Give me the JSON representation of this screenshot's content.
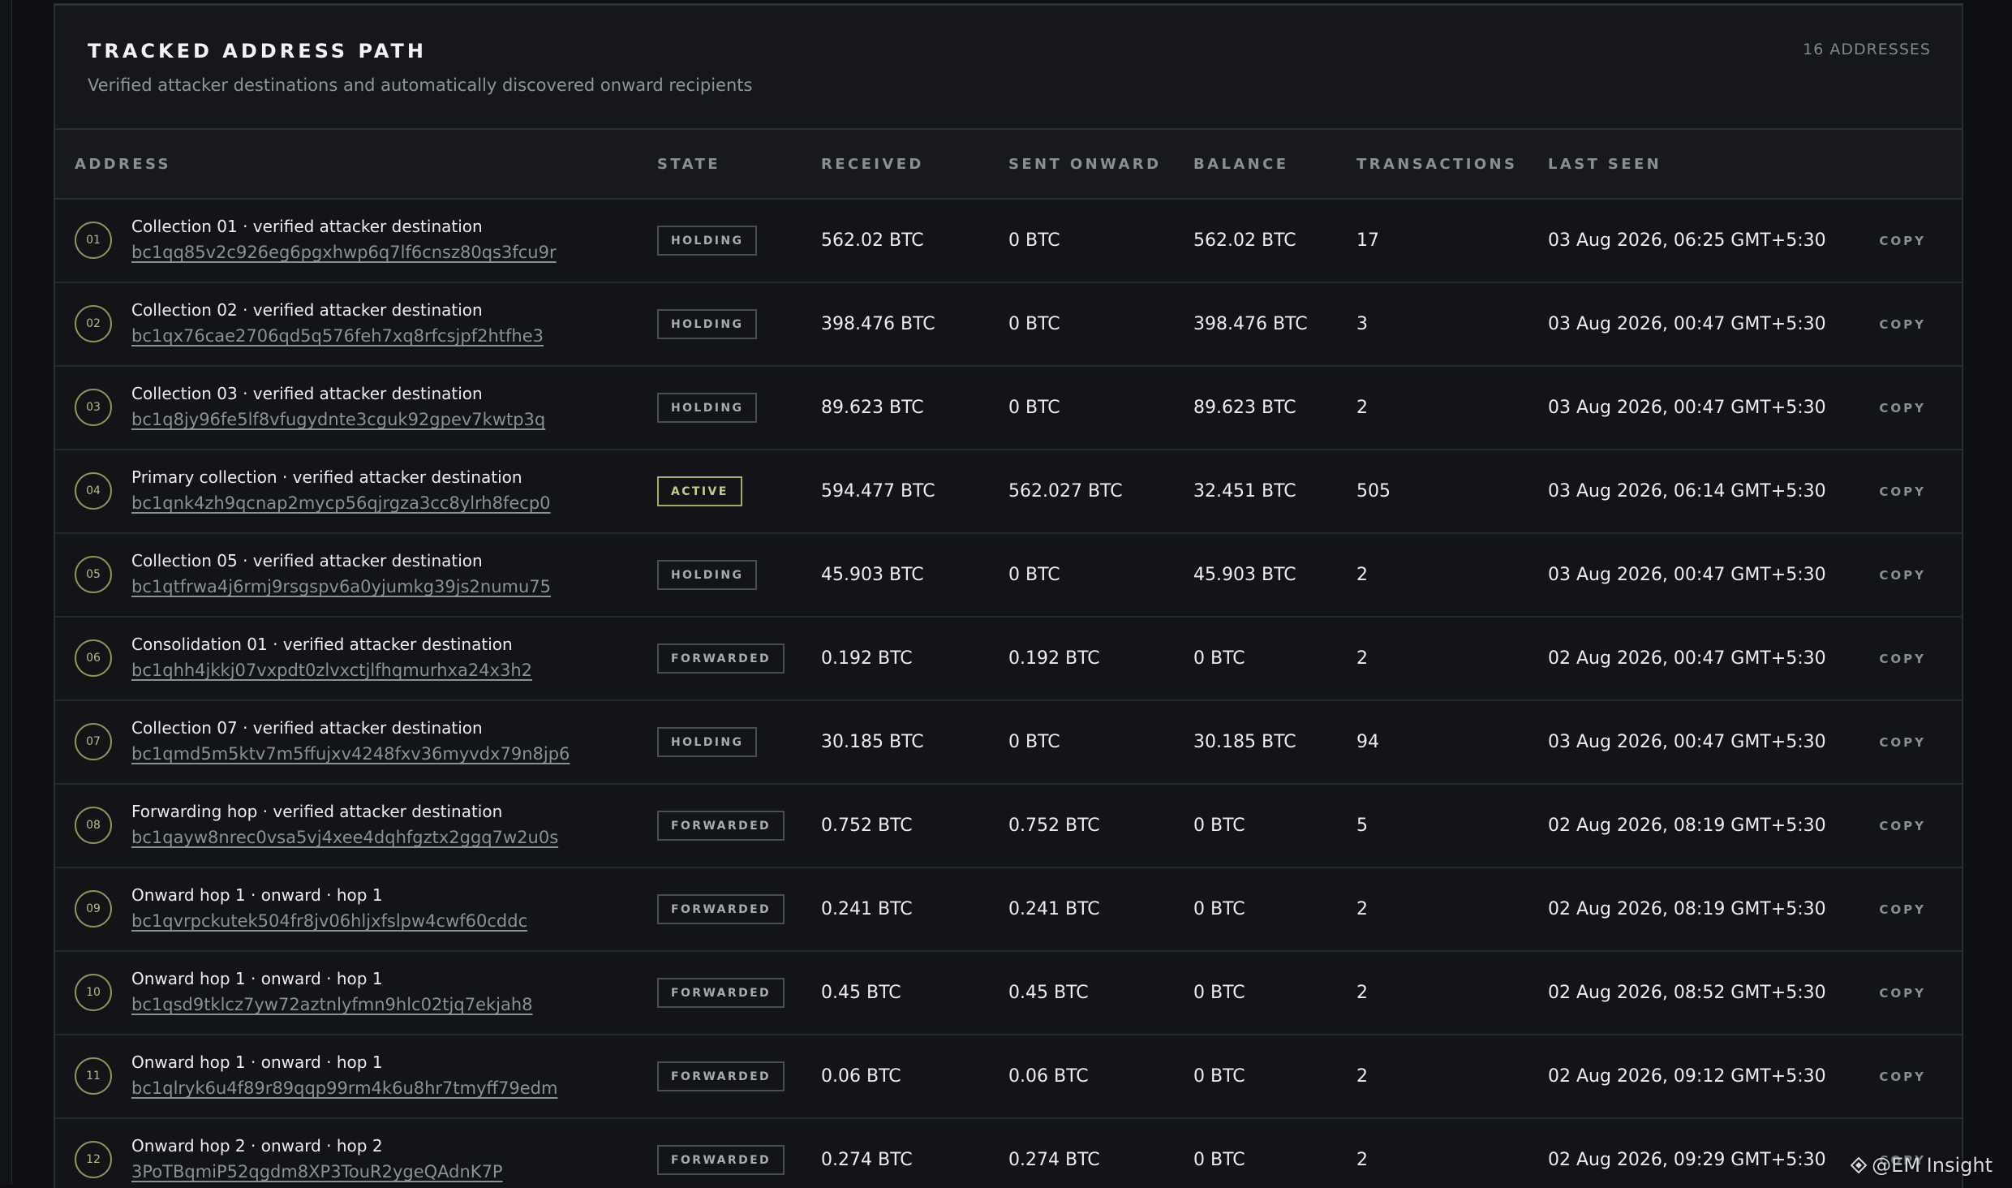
{
  "header": {
    "title": "TRACKED ADDRESS PATH",
    "subtitle": "Verified attacker destinations and automatically discovered onward recipients",
    "count": "16 ADDRESSES"
  },
  "columns": {
    "address": "ADDRESS",
    "state": "STATE",
    "received": "RECEIVED",
    "sent": "SENT ONWARD",
    "balance": "BALANCE",
    "transactions": "TRANSACTIONS",
    "last_seen": "LAST SEEN"
  },
  "copy_label": "COPY",
  "rows": [
    {
      "idx": "01",
      "label": "Collection 01 · verified attacker destination",
      "address": "bc1qq85v2c926eg6pgxhwp6q7lf6cnsz80qs3fcu9r",
      "state": "HOLDING",
      "received": "562.02 BTC",
      "sent": "0 BTC",
      "balance": "562.02 BTC",
      "tx": "17",
      "last_seen": "03 Aug 2026, 06:25 GMT+5:30"
    },
    {
      "idx": "02",
      "label": "Collection 02 · verified attacker destination",
      "address": "bc1qx76cae2706qd5q576feh7xq8rfcsjpf2htfhe3",
      "state": "HOLDING",
      "received": "398.476 BTC",
      "sent": "0 BTC",
      "balance": "398.476 BTC",
      "tx": "3",
      "last_seen": "03 Aug 2026, 00:47 GMT+5:30"
    },
    {
      "idx": "03",
      "label": "Collection 03 · verified attacker destination",
      "address": "bc1q8jy96fe5lf8vfugydnte3cguk92gpev7kwtp3q",
      "state": "HOLDING",
      "received": "89.623 BTC",
      "sent": "0 BTC",
      "balance": "89.623 BTC",
      "tx": "2",
      "last_seen": "03 Aug 2026, 00:47 GMT+5:30"
    },
    {
      "idx": "04",
      "label": "Primary collection · verified attacker destination",
      "address": "bc1qnk4zh9qcnap2mycp56qjrgza3cc8ylrh8fecp0",
      "state": "ACTIVE",
      "received": "594.477 BTC",
      "sent": "562.027 BTC",
      "balance": "32.451 BTC",
      "tx": "505",
      "last_seen": "03 Aug 2026, 06:14 GMT+5:30"
    },
    {
      "idx": "05",
      "label": "Collection 05 · verified attacker destination",
      "address": "bc1qtfrwa4j6rmj9rsgspv6a0yjumkg39js2numu75",
      "state": "HOLDING",
      "received": "45.903 BTC",
      "sent": "0 BTC",
      "balance": "45.903 BTC",
      "tx": "2",
      "last_seen": "03 Aug 2026, 00:47 GMT+5:30"
    },
    {
      "idx": "06",
      "label": "Consolidation 01 · verified attacker destination",
      "address": "bc1qhh4jkkj07vxpdt0zlvxctjlfhqmurhxa24x3h2",
      "state": "FORWARDED",
      "received": "0.192 BTC",
      "sent": "0.192 BTC",
      "balance": "0 BTC",
      "tx": "2",
      "last_seen": "02 Aug 2026, 00:47 GMT+5:30"
    },
    {
      "idx": "07",
      "label": "Collection 07 · verified attacker destination",
      "address": "bc1qmd5m5ktv7m5ffujxv4248fxv36myvdx79n8jp6",
      "state": "HOLDING",
      "received": "30.185 BTC",
      "sent": "0 BTC",
      "balance": "30.185 BTC",
      "tx": "94",
      "last_seen": "03 Aug 2026, 00:47 GMT+5:30"
    },
    {
      "idx": "08",
      "label": "Forwarding hop · verified attacker destination",
      "address": "bc1qayw8nrec0vsa5vj4xee4dqhfgztx2ggq7w2u0s",
      "state": "FORWARDED",
      "received": "0.752 BTC",
      "sent": "0.752 BTC",
      "balance": "0 BTC",
      "tx": "5",
      "last_seen": "02 Aug 2026, 08:19 GMT+5:30"
    },
    {
      "idx": "09",
      "label": "Onward hop 1 · onward · hop 1",
      "address": "bc1qvrpckutek504fr8jv06hljxfslpw4cwf60cddc",
      "state": "FORWARDED",
      "received": "0.241 BTC",
      "sent": "0.241 BTC",
      "balance": "0 BTC",
      "tx": "2",
      "last_seen": "02 Aug 2026, 08:19 GMT+5:30"
    },
    {
      "idx": "10",
      "label": "Onward hop 1 · onward · hop 1",
      "address": "bc1qsd9tklcz7yw72aztnlyfmn9hlc02tjq7ekjah8",
      "state": "FORWARDED",
      "received": "0.45 BTC",
      "sent": "0.45 BTC",
      "balance": "0 BTC",
      "tx": "2",
      "last_seen": "02 Aug 2026, 08:52 GMT+5:30"
    },
    {
      "idx": "11",
      "label": "Onward hop 1 · onward · hop 1",
      "address": "bc1qlryk6u4f89r89qqp99rm4k6u8hr7tmyff79edm",
      "state": "FORWARDED",
      "received": "0.06 BTC",
      "sent": "0.06 BTC",
      "balance": "0 BTC",
      "tx": "2",
      "last_seen": "02 Aug 2026, 09:12 GMT+5:30"
    },
    {
      "idx": "12",
      "label": "Onward hop 2 · onward · hop 2",
      "address": "3PoTBqmiP52qgdm8XP3TouR2ygeQAdnK7P",
      "state": "FORWARDED",
      "received": "0.274 BTC",
      "sent": "0.274 BTC",
      "balance": "0 BTC",
      "tx": "2",
      "last_seen": "02 Aug 2026, 09:29 GMT+5:30"
    }
  ],
  "watermark": "@EM Insight",
  "colors": {
    "accent": "#a6ab5f",
    "background": "#15171a",
    "row_bg": "#121417"
  }
}
